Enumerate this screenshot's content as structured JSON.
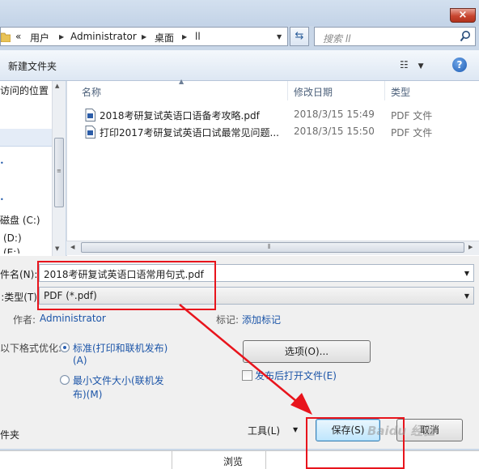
{
  "address": {
    "overflow": "«",
    "crumbs": [
      "用户",
      "Administrator",
      "桌面",
      "ll"
    ]
  },
  "search": {
    "placeholder": "搜索 ll"
  },
  "toolbar": {
    "new_folder": "新建文件夹"
  },
  "nav": {
    "items": [
      "访问的位置",
      "磁盘 (C:)",
      "(D:)",
      "(E:)"
    ]
  },
  "columns": {
    "name": "名称",
    "modified": "修改日期",
    "type": "类型"
  },
  "files": [
    {
      "name": "2018考研复试英语口语备考攻略.pdf",
      "date": "2018/3/15 15:49",
      "type": "PDF 文件"
    },
    {
      "name": "打印2017考研复试英语口试最常见问题...",
      "date": "2018/3/15 15:50",
      "type": "PDF 文件"
    }
  ],
  "form": {
    "filename_label": "件名(N):",
    "filename_value": "2018考研复试英语口语常用句式.pdf",
    "filetype_label": "类型(T):",
    "filetype_value": "PDF (*.pdf)",
    "author_label": "作者:",
    "author_value": "Administrator",
    "tags_label": "标记:",
    "tags_value": "添加标记",
    "optimize_label": "以下格式优化:",
    "option_standard_line1": "标准(打印和联机发布)",
    "option_standard_line2": "(A)",
    "option_min_line1": "最小文件大小(联机发",
    "option_min_line2": "布)(M)",
    "options_button": "选项(O)...",
    "open_after_label": "发布后打开文件(E)",
    "hide_folders": "件夹",
    "tools_label": "工具(L)",
    "save_button": "保存(S)",
    "cancel_button": "取消"
  },
  "bottom": {
    "browse": "浏览"
  },
  "watermark": "Baidu 经验",
  "colors": {
    "annotation_red": "#e8141c",
    "link_blue": "#1c55a8"
  }
}
